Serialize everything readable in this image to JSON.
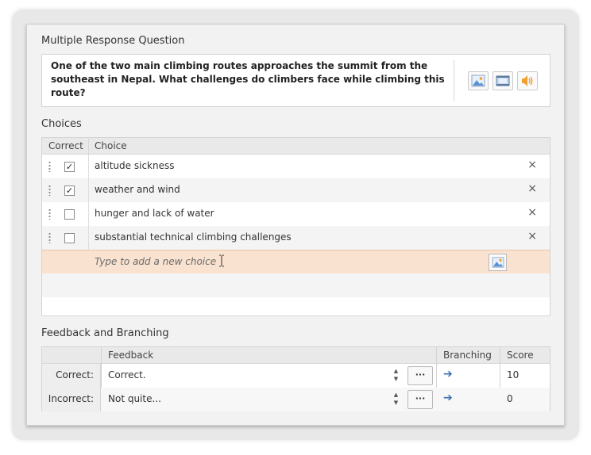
{
  "question": {
    "section_title": "Multiple Response Question",
    "text": "One of the two main climbing routes approaches the summit from the southeast in Nepal. What challenges do climbers face while climbing this route?",
    "media_buttons": [
      "image-icon",
      "video-icon",
      "audio-icon"
    ]
  },
  "choices": {
    "section_title": "Choices",
    "col_correct": "Correct",
    "col_choice": "Choice",
    "items": [
      {
        "label": "altitude sickness",
        "correct": true
      },
      {
        "label": "weather and wind",
        "correct": true
      },
      {
        "label": "hunger and lack of water",
        "correct": false
      },
      {
        "label": "substantial technical climbing challenges",
        "correct": false
      }
    ],
    "new_choice_placeholder": "Type to add a new choice",
    "delete_glyph": "×",
    "check_glyph": "✓"
  },
  "feedback": {
    "section_title": "Feedback and Branching",
    "col_feedback": "Feedback",
    "col_branching": "Branching",
    "col_score": "Score",
    "rows": [
      {
        "label": "Correct:",
        "text": "Correct.",
        "score": "10"
      },
      {
        "label": "Incorrect:",
        "text": "Not quite...",
        "score": "0"
      }
    ],
    "more_glyph": "···",
    "arrow_glyph": "➔"
  },
  "colors": {
    "new_row_bg": "#f9e2cf",
    "panel_bg": "#f2f2f2",
    "arrow": "#3a6fb0"
  }
}
